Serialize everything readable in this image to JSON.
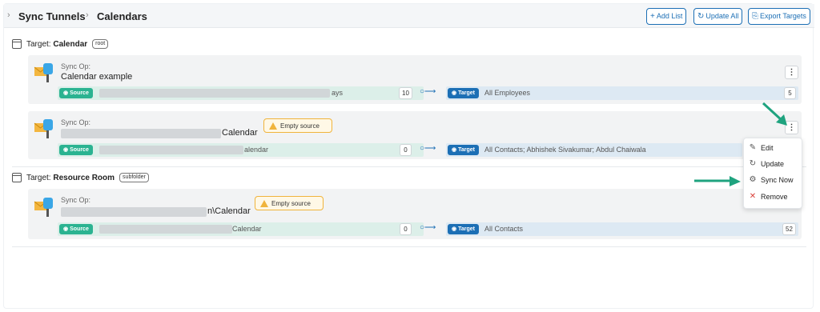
{
  "breadcrumb": {
    "items": [
      "Sync Tunnels",
      "Calendars"
    ]
  },
  "toolbar": {
    "add_list": "Add List",
    "update_all": "Update All",
    "export_targets": "Export Targets"
  },
  "groups": [
    {
      "label": "Target: ",
      "name": "Calendar",
      "tag": "root"
    },
    {
      "label": "Target: ",
      "name": "Resource Room",
      "tag": "subfolder"
    }
  ],
  "rows": [
    {
      "syncop_label": "Sync Op:",
      "title": "Calendar example",
      "source_pill": "Source",
      "source_text_suffix": "ays",
      "source_count": "10",
      "target_pill": "Target",
      "target_text": "All Employees",
      "target_count": "5"
    },
    {
      "syncop_label": "Sync Op:",
      "title": "Calendar",
      "warning": "Empty source",
      "source_pill": "Source",
      "source_text_suffix": "alendar",
      "source_count": "0",
      "target_pill": "Target",
      "target_text": "All Contacts; Abhishek Sivakumar; Abdul Chaiwala",
      "target_count": ""
    },
    {
      "syncop_label": "Sync Op:",
      "title": "n\\Calendar",
      "warning": "Empty source",
      "source_pill": "Source",
      "source_text_suffix": "Calendar",
      "source_count": "0",
      "target_pill": "Target",
      "target_text": "All Contacts",
      "target_count": "52"
    }
  ],
  "context_menu": {
    "items": [
      {
        "label": "Edit",
        "icon": "pencil-icon"
      },
      {
        "label": "Update",
        "icon": "refresh-icon"
      },
      {
        "label": "Sync Now",
        "icon": "gear-icon"
      },
      {
        "label": "Remove",
        "icon": "close-icon"
      }
    ]
  },
  "colors": {
    "accent": "#1c6fb5",
    "source": "#2bb391",
    "warning": "#f0b43c",
    "danger": "#d9413a",
    "annotation_arrow": "#1fa37f"
  }
}
